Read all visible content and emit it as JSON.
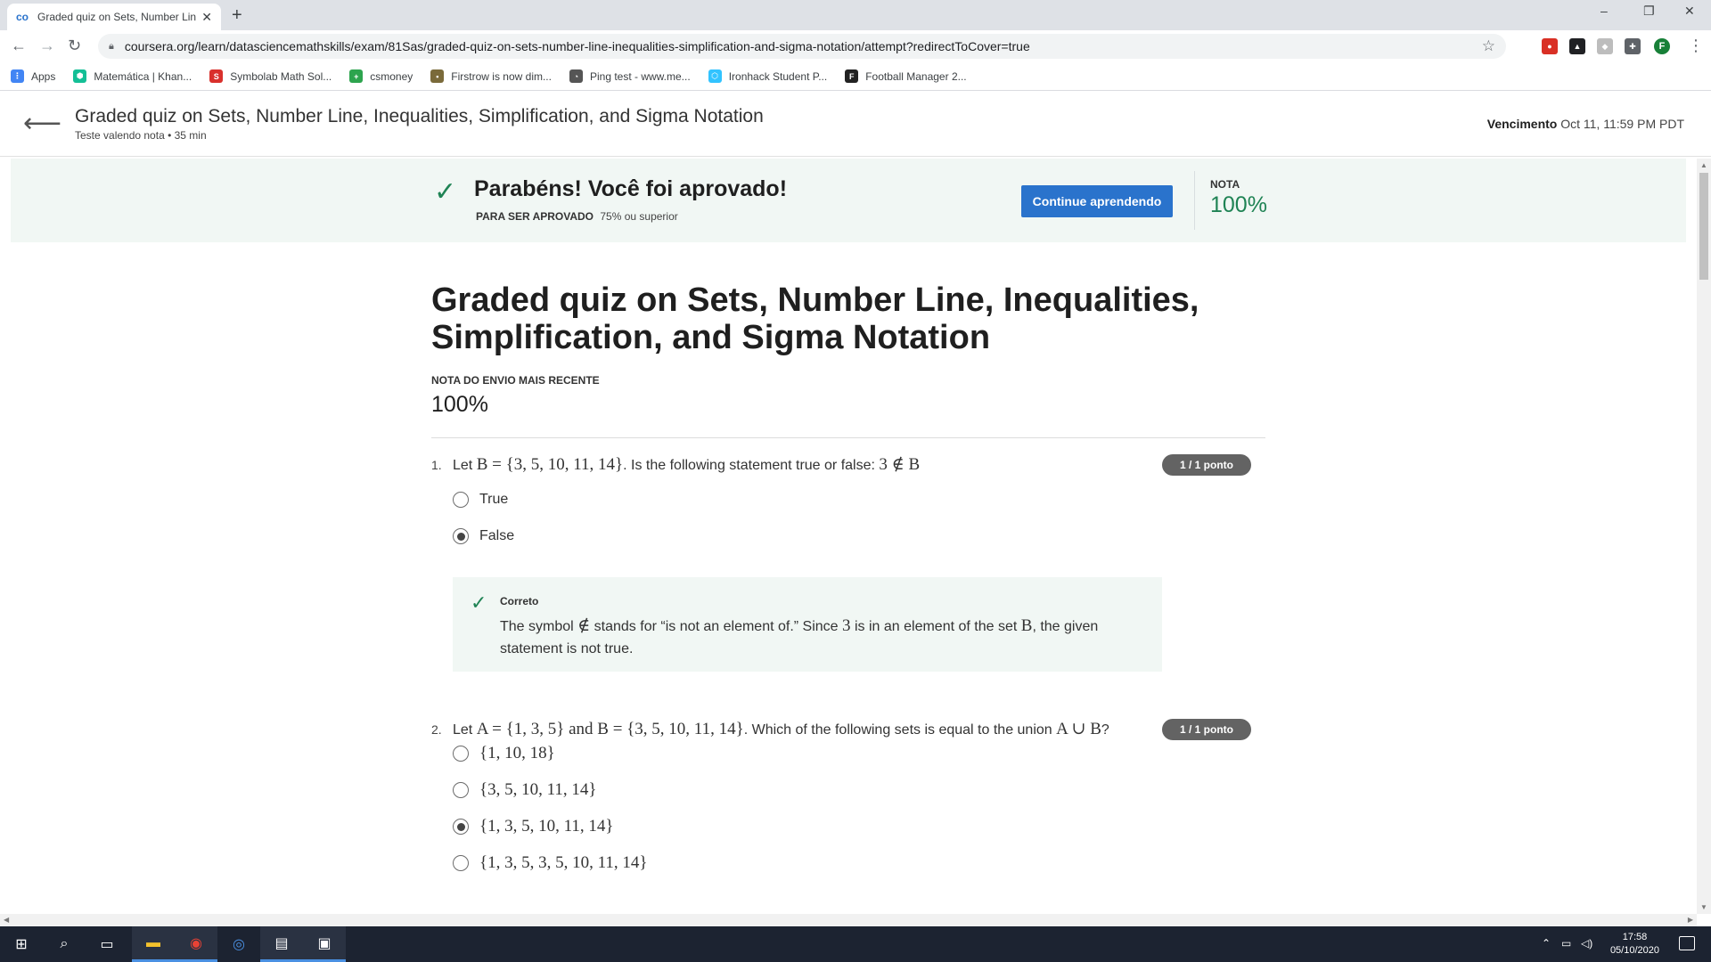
{
  "browser": {
    "tab_title": "Graded quiz on Sets, Number Lin",
    "tab_favicon": "co",
    "new_tab": "+",
    "url": "coursera.org/learn/datasciencemathskills/exam/81Sas/graded-quiz-on-sets-number-line-inequalities-simplification-and-sigma-notation/attempt?redirectToCover=true",
    "window_controls": {
      "minimize": "–",
      "restore": "❐",
      "close": "✕"
    },
    "profile_initial": "F"
  },
  "bookmarks": [
    {
      "label": "Apps",
      "icon": "apps-grid-icon",
      "color": "#4285f4"
    },
    {
      "label": "Matemática | Khan...",
      "icon": "khan-academy-icon",
      "color": "#14bf96"
    },
    {
      "label": "Symbolab Math Sol...",
      "icon": "symbolab-icon",
      "color": "#d9302c"
    },
    {
      "label": "csmoney",
      "icon": "csmoney-icon",
      "color": "#2da44e"
    },
    {
      "label": "Firstrow is now dim...",
      "icon": "firstrow-icon",
      "color": "#7a6a3a"
    },
    {
      "label": "Ping test - www.me...",
      "icon": "ping-test-icon",
      "color": "#555555"
    },
    {
      "label": "Ironhack Student P...",
      "icon": "ironhack-icon",
      "color": "#32c3ff"
    },
    {
      "label": "Football Manager 2...",
      "icon": "football-manager-icon",
      "color": "#222222"
    }
  ],
  "header": {
    "title": "Graded quiz on Sets, Number Line, Inequalities, Simplification, and Sigma Notation",
    "subtitle": "Teste valendo nota • 35 min",
    "due_label": "Vencimento",
    "due_value": "Oct 11, 11:59 PM PDT"
  },
  "banner": {
    "message": "Parabéns! Você foi aprovado!",
    "pass_label": "PARA SER APROVADO",
    "pass_value": "75% ou superior",
    "button_label": "Continue aprendendo",
    "grade_label": "NOTA",
    "grade_value": "100%"
  },
  "quiz": {
    "title": "Graded quiz on Sets, Number Line, Inequalities, Simplification, and Sigma Notation",
    "recent_label": "NOTA DO ENVIO MAIS RECENTE",
    "recent_value": "100%"
  },
  "questions": [
    {
      "number": "1.",
      "text_before": "Let ",
      "math_1": "B = {3, 5, 10, 11, 14}",
      "text_after": ". Is the following statement true or false: ",
      "math_2": "3 ∉ B",
      "points": "1 / 1 ponto",
      "options": [
        {
          "label": "True",
          "selected": false
        },
        {
          "label": "False",
          "selected": true
        }
      ],
      "feedback": {
        "label": "Correto",
        "t1": "The symbol ",
        "m1": "∉",
        "t2": " stands for “is not an element of.” Since ",
        "m2": "3",
        "t3": " is in an element of the set ",
        "m3": "B",
        "t4": ", the given statement is not true."
      }
    },
    {
      "number": "2.",
      "text_before": "Let ",
      "math_1": "A = {1, 3, 5}",
      "text_mid": " and ",
      "math_2": "B = {3, 5, 10, 11, 14}",
      "text_after": ". Which of the following sets is equal to the union ",
      "math_3": "A ∪ B",
      "text_end": "?",
      "points": "1 / 1 ponto",
      "options": [
        {
          "label": "{1, 10, 18}",
          "selected": false
        },
        {
          "label": "{3, 5, 10, 11, 14}",
          "selected": false
        },
        {
          "label": "{1, 3, 5, 10, 11, 14}",
          "selected": true
        },
        {
          "label": "{1, 3, 5, 3, 5, 10, 11, 14}",
          "selected": false
        }
      ]
    }
  ],
  "taskbar": {
    "time": "17:58",
    "date": "05/10/2020"
  }
}
